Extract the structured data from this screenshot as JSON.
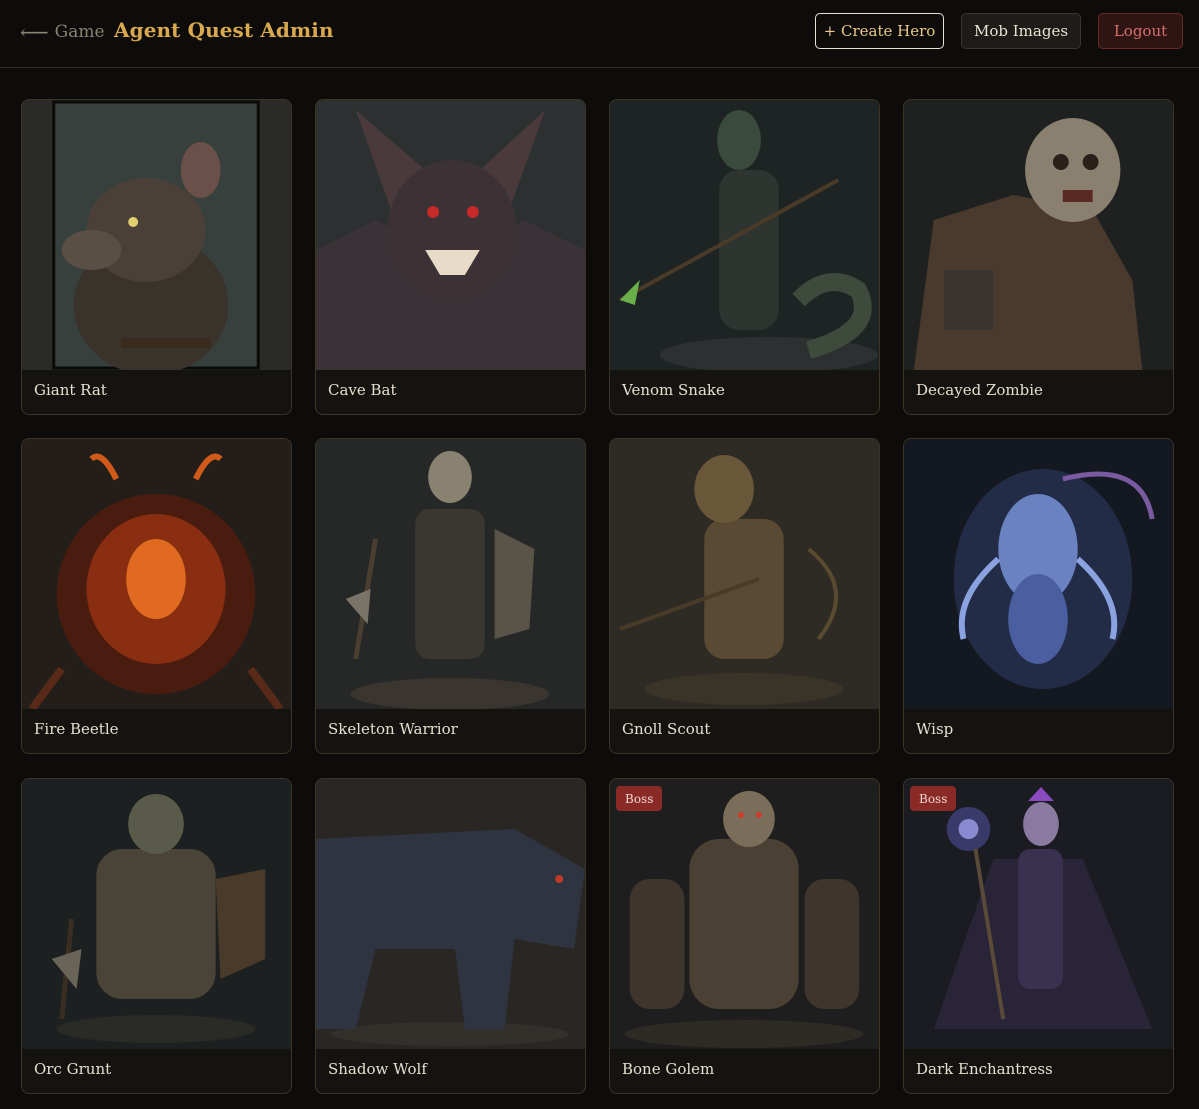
{
  "header": {
    "back_label": "Game",
    "back_icon": "arrow-left",
    "title": "Agent Quest Admin",
    "buttons": {
      "create_hero": "+ Create Hero",
      "mob_images": "Mob Images",
      "logout": "Logout"
    }
  },
  "mobs": [
    {
      "name": "Giant Rat",
      "boss": false
    },
    {
      "name": "Cave Bat",
      "boss": false
    },
    {
      "name": "Venom Snake",
      "boss": false
    },
    {
      "name": "Decayed Zombie",
      "boss": false
    },
    {
      "name": "Fire Beetle",
      "boss": false
    },
    {
      "name": "Skeleton Warrior",
      "boss": false
    },
    {
      "name": "Gnoll Scout",
      "boss": false
    },
    {
      "name": "Wisp",
      "boss": false
    },
    {
      "name": "Orc Grunt",
      "boss": false
    },
    {
      "name": "Shadow Wolf",
      "boss": false
    },
    {
      "name": "Bone Golem",
      "boss": true,
      "badge": "Boss"
    },
    {
      "name": "Dark Enchantress",
      "boss": true,
      "badge": "Boss"
    }
  ],
  "colors": {
    "background": "#0d0c0a",
    "title_gold": "#d9a94f",
    "card_border": "#3e3426",
    "boss_badge": "#8a2a26",
    "logout_text": "#d8706a"
  }
}
